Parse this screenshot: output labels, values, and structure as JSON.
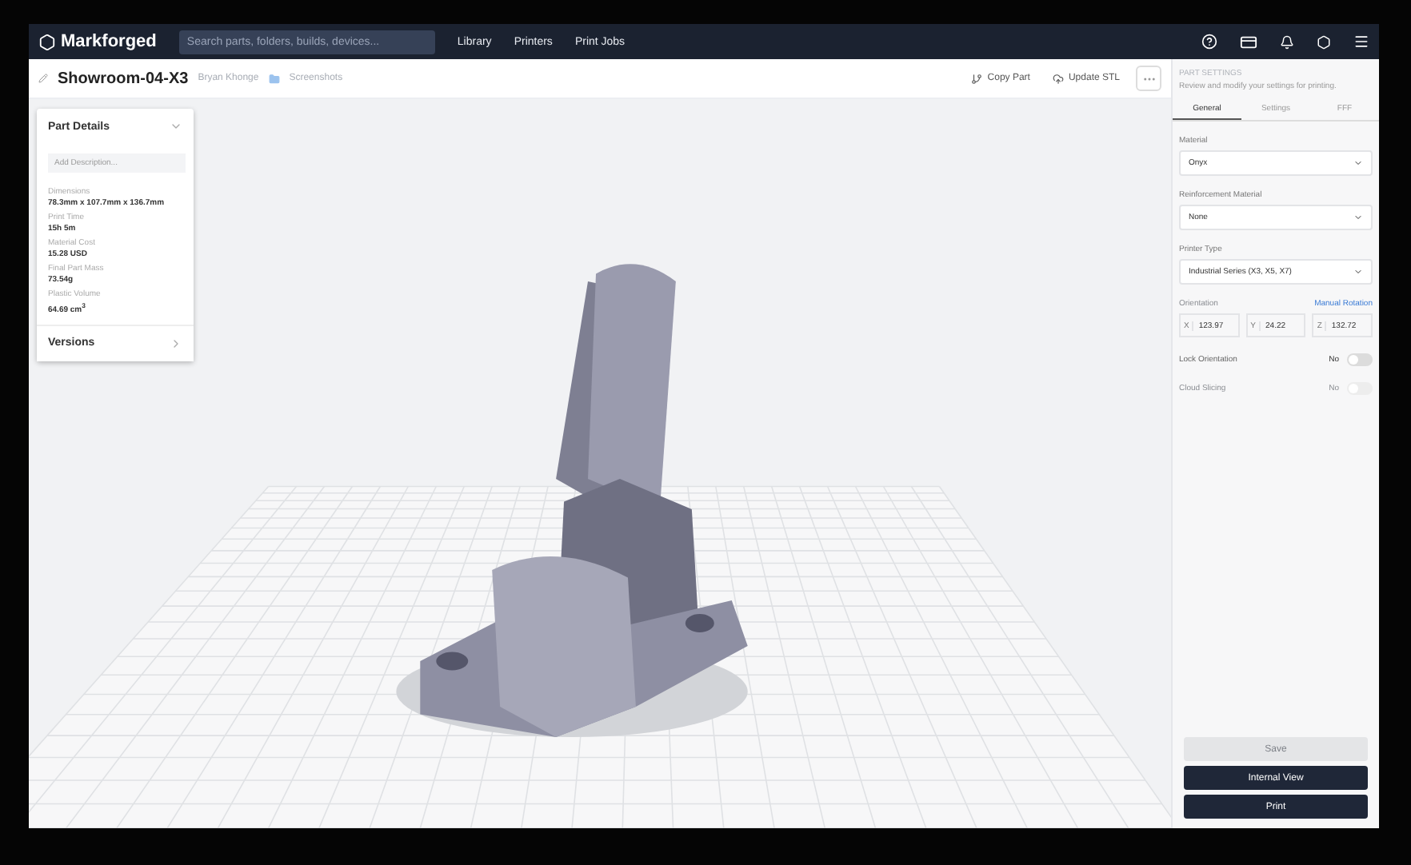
{
  "brand": "Markforged",
  "search": {
    "placeholder": "Search parts, folders, builds, devices..."
  },
  "nav": [
    {
      "label": "Library"
    },
    {
      "label": "Printers"
    },
    {
      "label": "Print Jobs"
    }
  ],
  "header": {
    "title": "Showroom-04-X3",
    "owner": "Bryan Khonge",
    "folder": "Screenshots",
    "actions": [
      {
        "label": "Copy Part",
        "kind": "copy"
      },
      {
        "label": "Update STL",
        "kind": "update"
      }
    ]
  },
  "details": {
    "title": "Part Details",
    "placeholder": "Add Description...",
    "fields": [
      {
        "label": "Dimensions",
        "value": "78.3mm x 107.7mm x 136.7mm"
      },
      {
        "label": "Print Time",
        "value": "15h 5m"
      },
      {
        "label": "Material Cost",
        "value": "15.28 USD"
      },
      {
        "label": "Final Part Mass",
        "value": "73.54g"
      },
      {
        "label": "Plastic Volume",
        "value": "64.69 cm$^{3}$"
      }
    ],
    "versions": "Versions"
  },
  "settings": {
    "heading": "PART SETTINGS",
    "subtitle": "Review and modify your settings for printing.",
    "tabs": [
      {
        "label": "General",
        "selected": true
      },
      {
        "label": "Settings",
        "selected": false
      },
      {
        "label": "FFF",
        "selected": false
      }
    ],
    "selects": [
      {
        "label": "Material",
        "value": "Onyx"
      },
      {
        "label": "Reinforcement Material",
        "value": "None"
      },
      {
        "label": "Printer Type",
        "value": "Industrial Series (X3, X5, X7)"
      }
    ],
    "orientation": {
      "label": "Orientation",
      "link": "Manual Rotation",
      "axes": [
        {
          "axis": "X",
          "value": "123.97"
        },
        {
          "axis": "Y",
          "value": "24.22"
        },
        {
          "axis": "Z",
          "value": "132.72"
        }
      ]
    },
    "toggles": [
      {
        "label": "Lock Orientation",
        "state": "No",
        "on": false,
        "disabled": false
      },
      {
        "label": "Cloud Slicing",
        "state": "No",
        "on": false,
        "disabled": true
      }
    ],
    "buttons": [
      {
        "label": "Save",
        "disabled": true
      },
      {
        "label": "Internal View",
        "disabled": false
      },
      {
        "label": "Print",
        "disabled": false
      }
    ]
  }
}
